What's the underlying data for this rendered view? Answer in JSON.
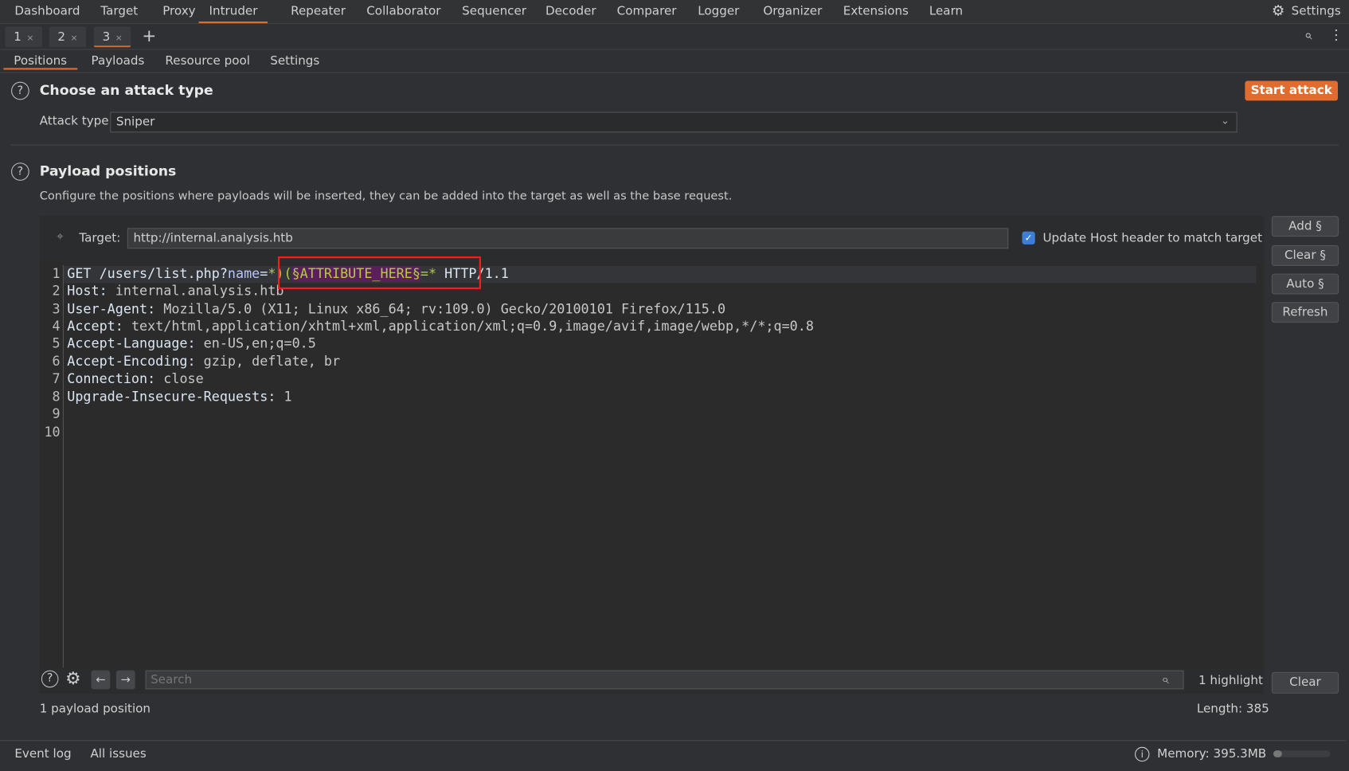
{
  "menu": [
    "Dashboard",
    "Target",
    "Proxy",
    "Intruder",
    "Repeater",
    "Collaborator",
    "Sequencer",
    "Decoder",
    "Comparer",
    "Logger",
    "Organizer",
    "Extensions",
    "Learn"
  ],
  "menu_active": "Intruder",
  "settings_label": "Settings",
  "request_tabs": [
    "1",
    "2",
    "3"
  ],
  "active_request_tab": "3",
  "sub_tabs": [
    "Positions",
    "Payloads",
    "Resource pool",
    "Settings"
  ],
  "attack": {
    "title": "Choose an attack type",
    "start_label": "Start attack",
    "type_label": "Attack type:",
    "type_value": "Sniper"
  },
  "positions": {
    "title": "Payload positions",
    "description": "Configure the positions where payloads will be inserted, they can be added into the target as well as the base request.",
    "target_label": "Target:",
    "target_value": "http://internal.analysis.htb",
    "update_host_label": "Update Host header to match target",
    "update_host_checked": true
  },
  "side_buttons": {
    "add": "Add §",
    "clear": "Clear §",
    "auto": "Auto §",
    "refresh": "Refresh"
  },
  "request": {
    "line1": {
      "method_path": "GET /users/list.php?",
      "param": "name",
      "eq": "=",
      "pre": "*)(",
      "payload": "§ATTRIBUTE_HERE§",
      "post": "=*",
      "proto": " HTTP/1.1"
    },
    "headers": [
      {
        "key": "Host",
        "value": "internal.analysis.htb"
      },
      {
        "key": "User-Agent",
        "value": "Mozilla/5.0 (X11; Linux x86_64; rv:109.0) Gecko/20100101 Firefox/115.0"
      },
      {
        "key": "Accept",
        "value": "text/html,application/xhtml+xml,application/xml;q=0.9,image/avif,image/webp,*/*;q=0.8"
      },
      {
        "key": "Accept-Language",
        "value": "en-US,en;q=0.5"
      },
      {
        "key": "Accept-Encoding",
        "value": "gzip, deflate, br"
      },
      {
        "key": "Connection",
        "value": "close"
      },
      {
        "key": "Upgrade-Insecure-Requests",
        "value": "1"
      }
    ],
    "line_numbers": [
      "1",
      "2",
      "3",
      "4",
      "5",
      "6",
      "7",
      "8",
      "9",
      "10"
    ]
  },
  "search": {
    "placeholder": "Search",
    "highlights": "1 highlight",
    "clear_label": "Clear"
  },
  "footer": {
    "payload_count": "1 payload position",
    "length": "Length: 385"
  },
  "status": {
    "event_log": "Event log",
    "all_issues": "All issues",
    "memory": "Memory: 395.3MB",
    "memory_fraction": 0.1
  },
  "colors": {
    "accent": "#e06c2f",
    "highlight_box": "#ff0000",
    "payload_bg": "#5b1f5b"
  }
}
